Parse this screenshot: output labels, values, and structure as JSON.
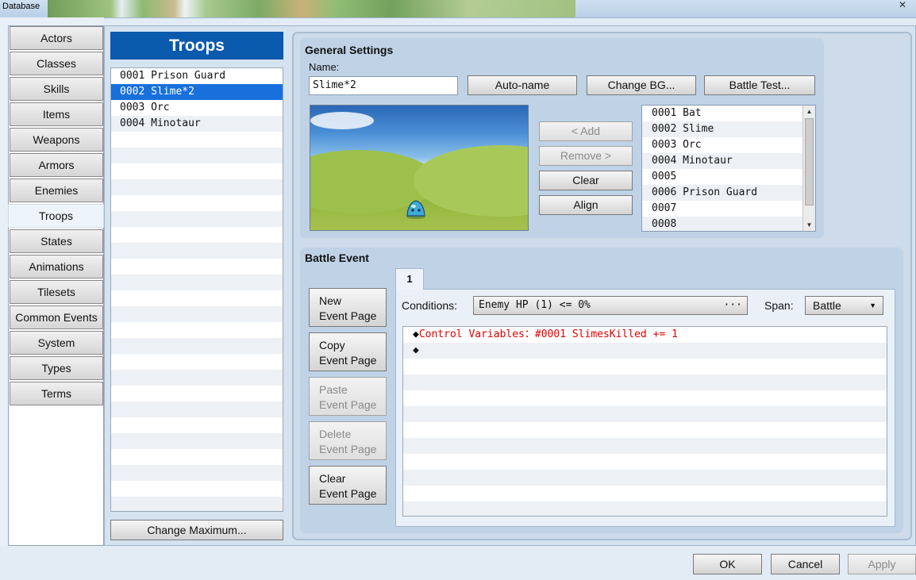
{
  "window": {
    "title": "Database",
    "close_glyph": "✕"
  },
  "sidebar": {
    "items": [
      "Actors",
      "Classes",
      "Skills",
      "Items",
      "Weapons",
      "Armors",
      "Enemies",
      "Troops",
      "States",
      "Animations",
      "Tilesets",
      "Common Events",
      "System",
      "Types",
      "Terms"
    ],
    "active": "Troops"
  },
  "troops": {
    "header": "Troops",
    "items": [
      "0001 Prison Guard",
      "0002 Slime*2",
      "0003 Orc",
      "0004 Minotaur"
    ],
    "selected_index": 1,
    "change_max_label": "Change Maximum..."
  },
  "general": {
    "title": "General Settings",
    "name_label": "Name:",
    "name_value": "Slime*2",
    "auto_name": "Auto-name",
    "change_bg": "Change BG...",
    "battle_test": "Battle Test...",
    "add": "< Add",
    "remove": "Remove >",
    "clear": "Clear",
    "align": "Align",
    "enemies": [
      "0001 Bat",
      "0002 Slime",
      "0003 Orc",
      "0004 Minotaur",
      "0005",
      "0006 Prison Guard",
      "0007",
      "0008"
    ]
  },
  "battle_event": {
    "title": "Battle Event",
    "tab_label": "1",
    "page_buttons": [
      {
        "l1": "New",
        "l2": "Event Page",
        "disabled": false
      },
      {
        "l1": "Copy",
        "l2": "Event Page",
        "disabled": false
      },
      {
        "l1": "Paste",
        "l2": "Event Page",
        "disabled": true
      },
      {
        "l1": "Delete",
        "l2": "Event Page",
        "disabled": true
      },
      {
        "l1": "Clear",
        "l2": "Event Page",
        "disabled": false
      }
    ],
    "conditions_label": "Conditions:",
    "conditions_value": "Enemy HP (1) <= 0%",
    "conditions_ellipsis": "···",
    "span_label": "Span:",
    "span_value": "Battle",
    "commands": [
      "◆Control Variables：#0001 SlimesKilled += 1",
      "◆"
    ]
  },
  "footer": {
    "ok": "OK",
    "cancel": "Cancel",
    "apply": "Apply"
  },
  "colors": {
    "accent": "#0a5aad",
    "selection": "#1770dc",
    "command_text": "#e00000"
  }
}
